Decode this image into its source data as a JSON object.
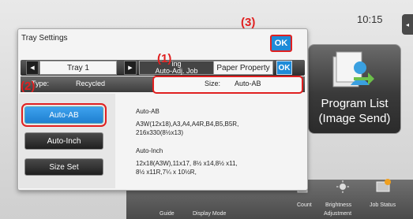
{
  "status": {
    "clock": "10:15"
  },
  "home": {
    "program_tile": {
      "label_line1": "Program List",
      "label_line2": "(Image Send)"
    },
    "bottom_bar": {
      "items": [
        "Count",
        "Brightness",
        "Job Status"
      ],
      "sub_items": [
        "Guide",
        "Display Mode",
        "Adjustment"
      ]
    }
  },
  "dialog": {
    "title": "Tray Settings",
    "tabs": {
      "tray": "Tray 1",
      "shading_line1": "ing",
      "shading_line2": "Auto-Adj. Job",
      "paper_property": "Paper Property",
      "ok": "OK"
    },
    "info": {
      "type_label": "Type:",
      "type_value": "Recycled",
      "size_label": "Size:",
      "size_value": "Auto-AB"
    },
    "options": [
      "Auto-AB",
      "Auto-Inch",
      "Size Set"
    ],
    "selected_option": "Auto-AB",
    "descriptions": {
      "ab_title": "Auto-AB",
      "ab_line1": "A3W(12x18),A3,A4,A4R,B4,B5,B5R,",
      "ab_line2": "216x330(8½x13)",
      "inch_title": "Auto-Inch",
      "inch_line1": "12x18(A3W),11x17, 8½ x14,8½ x11,",
      "inch_line2": "8½ x11R,7¼ x 10½R,"
    },
    "ok_button": "OK"
  },
  "callouts": {
    "c1": "(1)",
    "c2": "(2)",
    "c3": "(3)"
  },
  "colors": {
    "accent_blue": "#1e8bd8",
    "callout_red": "#e02020"
  }
}
